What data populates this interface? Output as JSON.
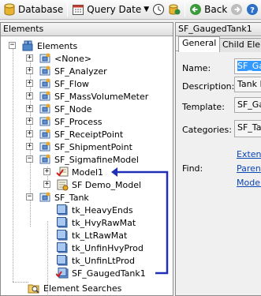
{
  "toolbar": {
    "database_label": "Database",
    "query_date_label": "Query Date",
    "back_label": "Back"
  },
  "left_panel": {
    "header": "Elements",
    "tree": {
      "root": "Elements",
      "items": [
        "<None>",
        "SF_Analyzer",
        "SF_Flow",
        "SF_MassVolumeMeter",
        "SF_Node",
        "SF_Process",
        "SF_ReceiptPoint",
        "SF_ShipmentPoint",
        "SF_SigmafineModel",
        "SF_Tank"
      ],
      "sigmafine_children": [
        "Model1",
        "SF Demo_Model"
      ],
      "tank_children": [
        "tk_HeavyEnds",
        "tk_HvyRawMat",
        "tk_LtRawMat",
        "tk_UnfinHvyProd",
        "tk_UnfinLtProd",
        "SF_GaugedTank1"
      ],
      "searches": "Element Searches"
    }
  },
  "right_panel": {
    "header": "SF_GaugedTank1",
    "tabs": [
      "General",
      "Child Elem"
    ],
    "fields": {
      "name_label": "Name:",
      "name_value": "SF_Ga",
      "description_label": "Description:",
      "description_value": "Tank I",
      "template_label": "Template:",
      "template_value": "SF_Ga",
      "categories_label": "Categories:",
      "categories_value": "SF_Ta",
      "find_label": "Find:",
      "find_links": [
        "Exten",
        "Paren",
        "Model"
      ]
    }
  },
  "colors": {
    "annotation_arrow": "#1f2fb8",
    "link": "#0a46b4",
    "selection": "#3399ff"
  }
}
